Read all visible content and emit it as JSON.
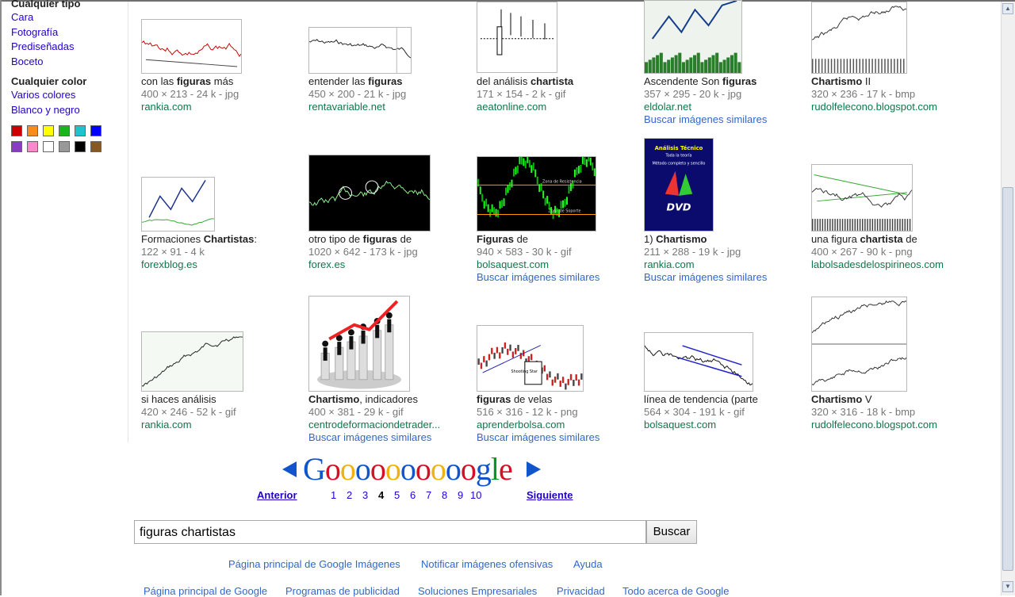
{
  "sidebar": {
    "type_heading": "Cualquier tipo",
    "type_items": [
      "Cara",
      "Fotografía",
      "Prediseñadas",
      "Boceto"
    ],
    "color_heading": "Cualquier color",
    "color_items": [
      "Varios colores",
      "Blanco y negro"
    ],
    "swatch_colors": [
      "#cc0000",
      "#f68d1a",
      "#ffff00",
      "#1bb51b",
      "#1ec3cc",
      "#0000ff",
      "#8a3cc2",
      "#ff88cc",
      "#ffffff",
      "#999999",
      "#000000",
      "#8a5721"
    ]
  },
  "results": [
    {
      "t_pre": "con las ",
      "t_bold": "figuras",
      "t_post": " más",
      "meta": "400 × 213 - 24 k - jpg",
      "site": "rankia.com",
      "similar": ""
    },
    {
      "t_pre": "entender las ",
      "t_bold": "figuras",
      "t_post": "",
      "meta": "450 × 200 - 21 k - jpg",
      "site": "rentavariable.net",
      "similar": ""
    },
    {
      "t_pre": "del análisis ",
      "t_bold": "chartista",
      "t_post": "",
      "meta": "171 × 154 - 2 k - gif",
      "site": "aeatonline.com",
      "similar": ""
    },
    {
      "t_pre": "Ascendente Son ",
      "t_bold": "figuras",
      "t_post": "",
      "meta": "357 × 295 - 20 k - jpg",
      "site": "eldolar.net",
      "similar": "Buscar imágenes similares"
    },
    {
      "t_pre": "",
      "t_bold": "Chartismo",
      "t_post": " II",
      "meta": "320 × 236 - 17 k - bmp",
      "site": "rudolfelecono.blogspot.com",
      "similar": ""
    },
    {
      "t_pre": "Formaciones ",
      "t_bold": "Chartistas",
      "t_post": ":",
      "meta": "122 × 91 - 4 k",
      "site": "forexblog.es",
      "similar": ""
    },
    {
      "t_pre": "otro tipo de ",
      "t_bold": "figuras",
      "t_post": " de",
      "meta": "1020 × 642 - 173 k - jpg",
      "site": "forex.es",
      "similar": ""
    },
    {
      "t_pre": "",
      "t_bold": "Figuras",
      "t_post": " de",
      "meta": "940 × 583 - 30 k - gif",
      "site": "bolsaquest.com",
      "similar": "Buscar imágenes similares"
    },
    {
      "t_pre": "1) ",
      "t_bold": "Chartismo",
      "t_post": "",
      "meta": "211 × 288 - 19 k - jpg",
      "site": "rankia.com",
      "similar": "Buscar imágenes similares"
    },
    {
      "t_pre": "una figura ",
      "t_bold": "chartista",
      "t_post": " de",
      "meta": "400 × 267 - 90 k - png",
      "site": "labolsadesdelospirineos.com",
      "similar": ""
    },
    {
      "t_pre": "si haces análisis",
      "t_bold": "",
      "t_post": "",
      "meta": "420 × 246 - 52 k - gif",
      "site": "rankia.com",
      "similar": ""
    },
    {
      "t_pre": "",
      "t_bold": "Chartismo",
      "t_post": ", indicadores",
      "meta": "400 × 381 - 29 k - gif",
      "site": "centrodeformaciondetrader...",
      "similar": "Buscar imágenes similares"
    },
    {
      "t_pre": "",
      "t_bold": "figuras",
      "t_post": " de velas",
      "meta": "516 × 316 - 12 k - png",
      "site": "aprenderbolsa.com",
      "similar": "Buscar imágenes similares"
    },
    {
      "t_pre": "línea de tendencia (parte",
      "t_bold": "",
      "t_post": "",
      "meta": "564 × 304 - 191 k - gif",
      "site": "bolsaquest.com",
      "similar": ""
    },
    {
      "t_pre": "",
      "t_bold": "Chartismo",
      "t_post": " V",
      "meta": "320 × 316 - 18 k - bmp",
      "site": "rudolfelecono.blogspot.com",
      "similar": ""
    }
  ],
  "thumb_text": {
    "dvd_title": "Análisis Técnico",
    "dvd_sub": "Toda la teoría",
    "dvd_desc": "Método completo y sencillo",
    "dvd_logo": "DVD",
    "resistance_label": "Zona de Resistencia",
    "support_label": "Zona de Soporte",
    "candle_label": "Shooting Star"
  },
  "pager": {
    "logo_letters": [
      "G",
      "o",
      "o",
      "o",
      "o",
      "o",
      "o",
      "o",
      "o",
      "o",
      "o",
      "g",
      "l",
      "e"
    ],
    "logo_colors": [
      "#1155cc",
      "#d50f25",
      "#eeb211",
      "#1155cc",
      "#d50f25",
      "#eeb211",
      "#1155cc",
      "#d50f25",
      "#eeb211",
      "#1155cc",
      "#d50f25",
      "#1155cc",
      "#009925",
      "#d50f25"
    ],
    "prev": "Anterior",
    "next": "Siguiente",
    "pages": [
      "1",
      "2",
      "3",
      "4",
      "5",
      "6",
      "7",
      "8",
      "9",
      "10"
    ],
    "current": "4"
  },
  "search": {
    "query": "figuras chartistas",
    "button": "Buscar"
  },
  "footer": {
    "row1": [
      "Página principal de Google Imágenes",
      "Notificar imágenes ofensivas",
      "Ayuda"
    ],
    "row2": [
      "Página principal de Google",
      "Programas de publicidad",
      "Soluciones Empresariales",
      "Privacidad",
      "Todo acerca de Google"
    ]
  }
}
